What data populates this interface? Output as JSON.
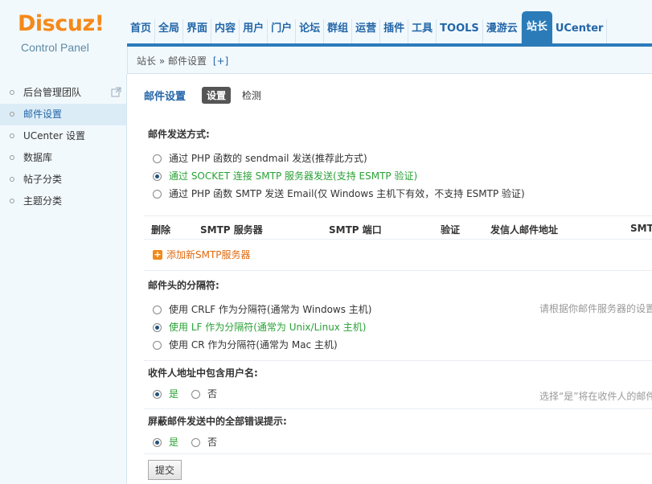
{
  "logo": {
    "brand": "Discuz!",
    "subtitle": "Control Panel"
  },
  "nav": {
    "tabs": [
      {
        "label": "首页"
      },
      {
        "label": "全局"
      },
      {
        "label": "界面"
      },
      {
        "label": "内容"
      },
      {
        "label": "用户"
      },
      {
        "label": "门户"
      },
      {
        "label": "论坛"
      },
      {
        "label": "群组"
      },
      {
        "label": "运营"
      },
      {
        "label": "插件"
      },
      {
        "label": "工具"
      },
      {
        "label": "TOOLS"
      },
      {
        "label": "漫游云"
      },
      {
        "label": "站长"
      },
      {
        "label": "UCenter"
      }
    ],
    "active_index": 13
  },
  "breadcrumb": {
    "text": "站长 » 邮件设置",
    "add_label": "[+]"
  },
  "sidebar": {
    "items": [
      {
        "label": "后台管理团队"
      },
      {
        "label": "邮件设置"
      },
      {
        "label": "UCenter 设置"
      },
      {
        "label": "数据库"
      },
      {
        "label": "帖子分类"
      },
      {
        "label": "主题分类"
      }
    ],
    "active_index": 1
  },
  "page": {
    "title": "邮件设置",
    "subtabs": [
      {
        "label": "设置"
      },
      {
        "label": "检测"
      }
    ]
  },
  "send_method": {
    "label": "邮件发送方式:",
    "options": [
      "通过 PHP 函数的 sendmail 发送(推荐此方式)",
      "通过 SOCKET 连接 SMTP 服务器发送(支持 ESMTP 验证)",
      "通过 PHP 函数 SMTP 发送 Email(仅 Windows 主机下有效，不支持 ESMTP 验证)"
    ],
    "selected": 1
  },
  "smtp_table": {
    "columns": [
      "删除",
      "SMTP 服务器",
      "SMTP 端口",
      "验证",
      "发信人邮件地址",
      "SMTP"
    ],
    "add_label": "添加新SMTP服务器"
  },
  "delimiter": {
    "label": "邮件头的分隔符:",
    "options": [
      "使用 CRLF 作为分隔符(通常为 Windows 主机)",
      "使用 LF 作为分隔符(通常为 Unix/Linux 主机)",
      "使用 CR 作为分隔符(通常为 Mac 主机)"
    ],
    "selected": 1,
    "tip": "请根据你邮件服务器的设置"
  },
  "include_username": {
    "label": "收件人地址中包含用户名:",
    "yes": "是",
    "no": "否",
    "selected": "yes",
    "tip": "选择“是”将在收件人的邮件"
  },
  "silent": {
    "label": "屏蔽邮件发送中的全部错误提示:",
    "yes": "是",
    "no": "否",
    "selected": "yes"
  },
  "submit_label": "提交",
  "colors": {
    "accent": "#2b7bb9",
    "selected_text": "#2aa136",
    "brand": "#f5891b",
    "add_link": "#e06a10"
  }
}
